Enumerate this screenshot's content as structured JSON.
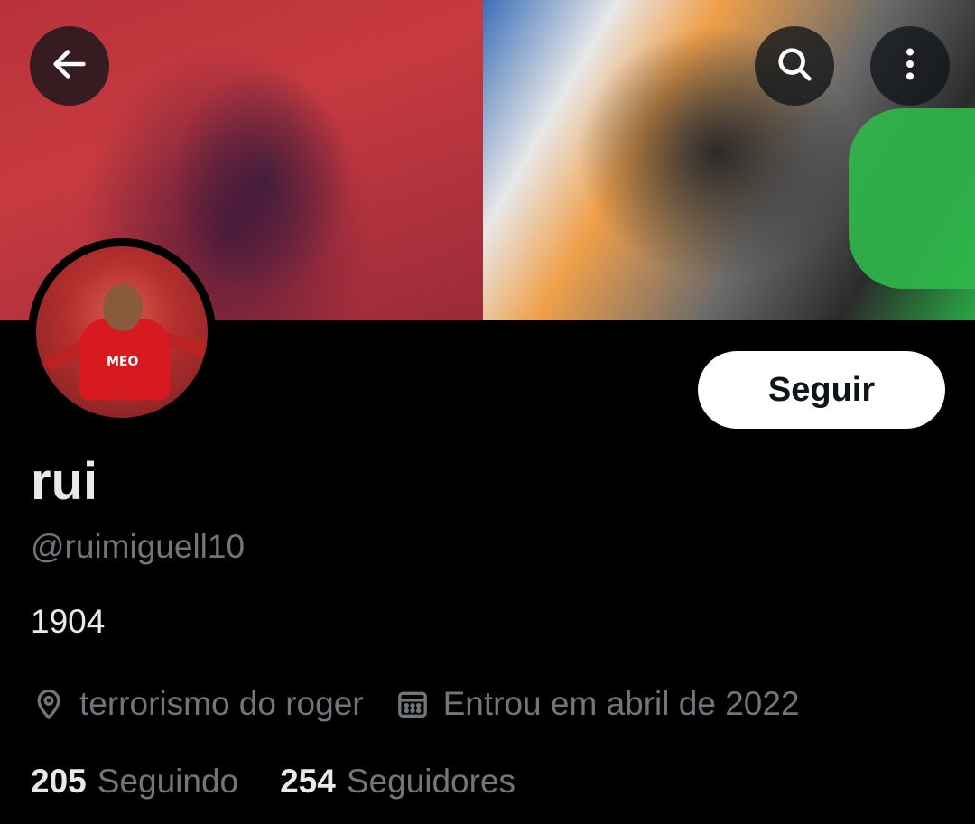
{
  "header": {
    "back_icon": "arrow-left-icon",
    "search_icon": "search-icon",
    "more_icon": "more-vertical-icon"
  },
  "profile": {
    "display_name": "rui",
    "handle": "@ruimiguell10",
    "bio": "1904",
    "location": "terrorismo do roger",
    "location_icon": "location-pin-icon",
    "joined": "Entrou em abril de 2022",
    "joined_icon": "calendar-icon",
    "follow_label": "Seguir",
    "avatar_shirt_text": "MEO"
  },
  "stats": {
    "following_count": "205",
    "following_label": "Seguindo",
    "followers_count": "254",
    "followers_label": "Seguidores"
  },
  "colors": {
    "background": "#000000",
    "primary_text": "#e7e9ea",
    "secondary_text": "#71767b",
    "follow_button_bg": "#ffffff",
    "follow_button_text": "#0f1419"
  }
}
